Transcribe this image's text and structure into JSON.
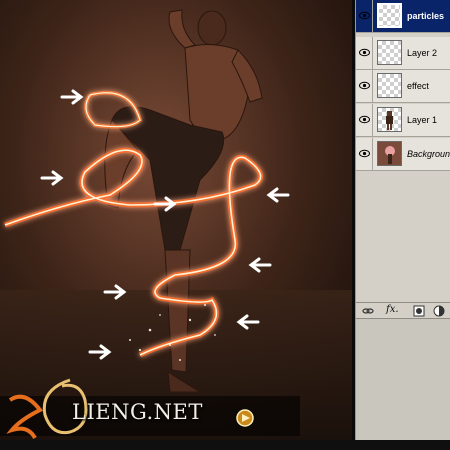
{
  "layers_panel": {
    "layers": [
      {
        "name": "particles",
        "visible": true,
        "selected": true,
        "thumb": "transparent",
        "italic": false
      },
      {
        "name": "Layer 2",
        "visible": true,
        "selected": false,
        "thumb": "transparent",
        "italic": false
      },
      {
        "name": "effect",
        "visible": true,
        "selected": false,
        "thumb": "transparent",
        "italic": false
      },
      {
        "name": "Layer 1",
        "visible": true,
        "selected": false,
        "thumb": "figure",
        "italic": false
      },
      {
        "name": "Background",
        "visible": true,
        "selected": false,
        "thumb": "photo",
        "italic": true
      }
    ],
    "footer": {
      "link_icon": "link-icon",
      "fx_label": "fx.",
      "mask_icon": "layer-mask-icon",
      "adjustment_icon": "adjustment-layer-icon"
    }
  },
  "canvas": {
    "arrow_icon": "arrow-right-icon",
    "arrow_count": 8,
    "watermark_text": "LIENG.NET"
  },
  "colors": {
    "selected_layer": "#0a246a",
    "glow_core": "#fff3d6",
    "glow_outer": "#ff6a1a",
    "arrow": "#ffffff",
    "panel_bg": "#d4d0c8"
  }
}
